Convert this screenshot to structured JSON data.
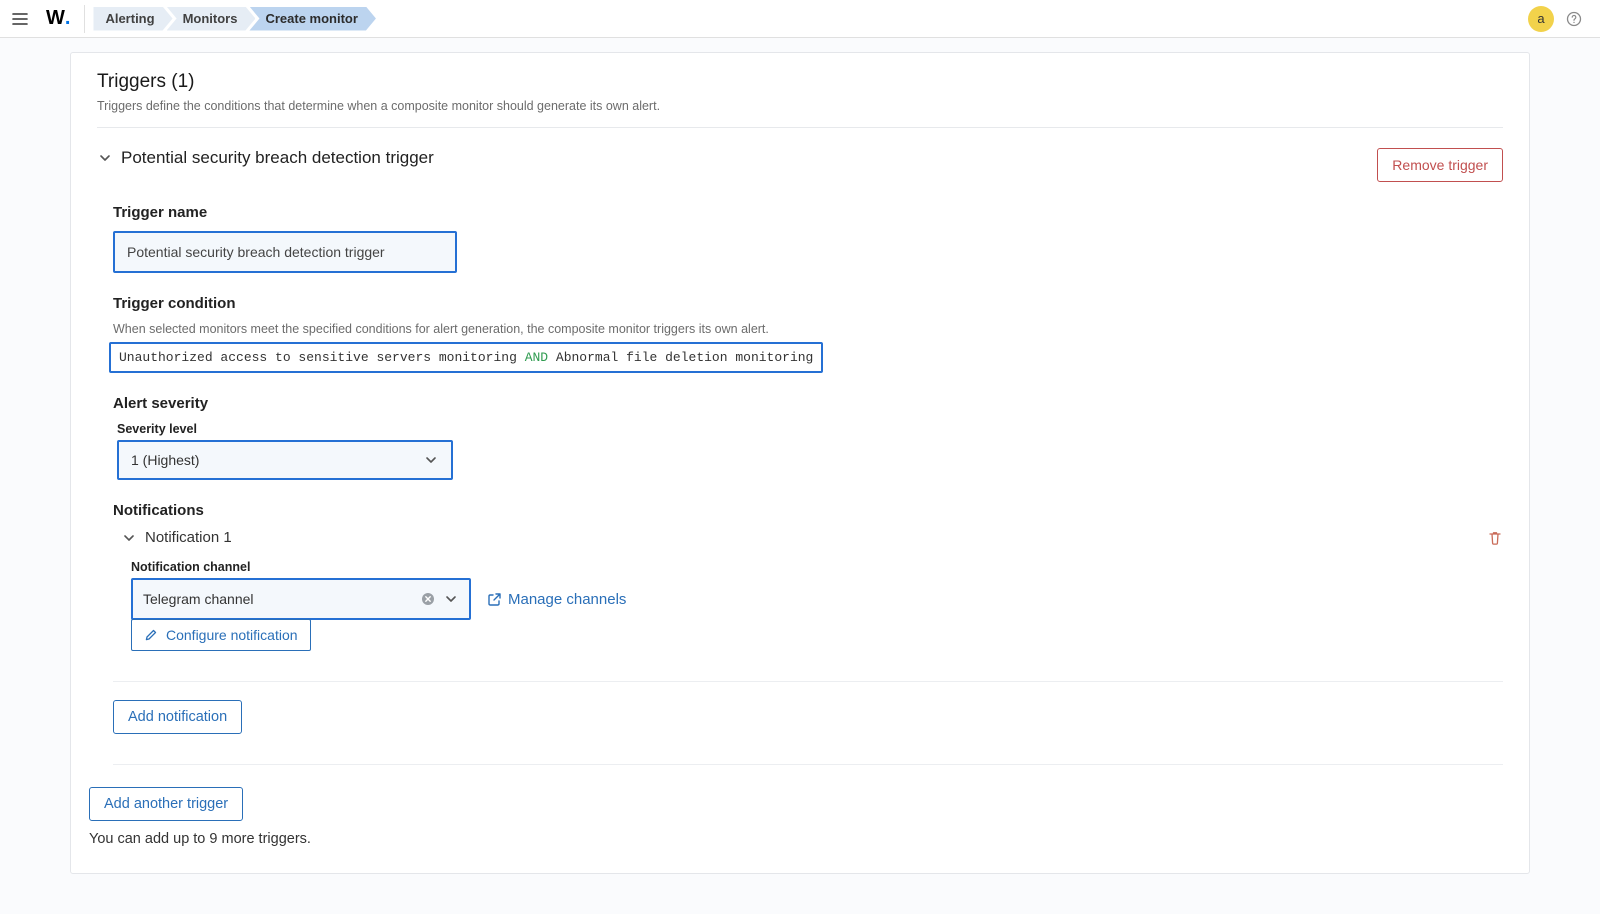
{
  "header": {
    "logo_text": "W",
    "logo_dot": ".",
    "breadcrumbs": [
      "Alerting",
      "Monitors",
      "Create monitor"
    ],
    "avatar_initial": "a"
  },
  "card": {
    "title": "Triggers (1)",
    "subtitle": "Triggers define the conditions that determine when a composite monitor should generate its own alert."
  },
  "trigger": {
    "title": "Potential security breach detection trigger",
    "remove_label": "Remove trigger",
    "name_label": "Trigger name",
    "name_value": "Potential security breach detection trigger",
    "condition_label": "Trigger condition",
    "condition_desc": "When selected monitors meet the specified conditions for alert generation, the composite monitor triggers its own alert.",
    "condition_part1": "Unauthorized access to sensitive servers monitoring",
    "condition_kw": "AND",
    "condition_part2": "Abnormal file deletion monitoring",
    "severity_label": "Alert severity",
    "severity_level_label": "Severity level",
    "severity_value": "1 (Highest)"
  },
  "notifications": {
    "section_label": "Notifications",
    "item_title": "Notification 1",
    "channel_label": "Notification channel",
    "channel_value": "Telegram channel",
    "manage_label": "Manage channels",
    "configure_label": "Configure notification",
    "add_label": "Add notification"
  },
  "footer": {
    "add_trigger_label": "Add another trigger",
    "note": "You can add up to 9 more triggers."
  }
}
